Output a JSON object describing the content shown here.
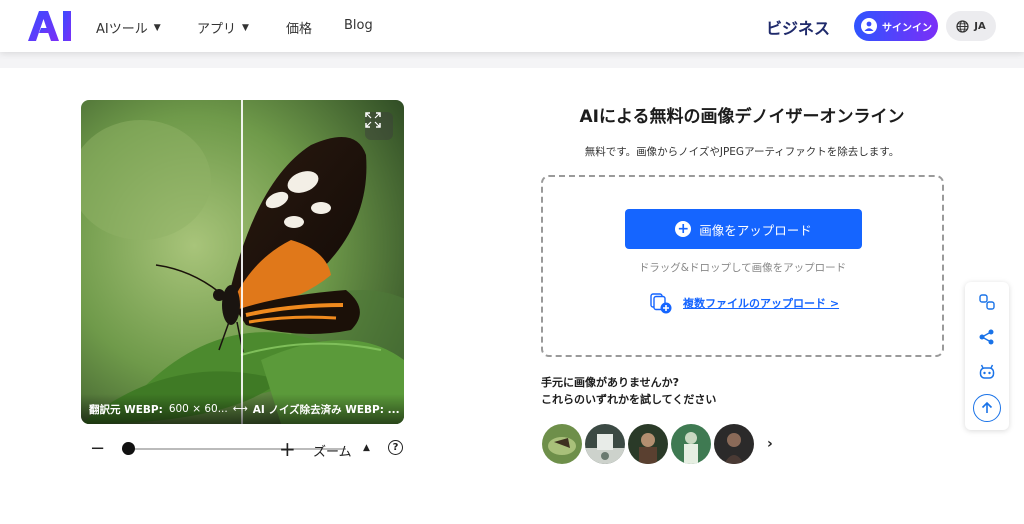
{
  "header": {
    "logo_text": "AI",
    "nav": [
      {
        "label": "AIツール",
        "dropdown": true
      },
      {
        "label": "アプリ",
        "dropdown": true
      },
      {
        "label": "価格",
        "dropdown": false
      },
      {
        "label": "Blog",
        "dropdown": false
      }
    ],
    "business_label": "ビジネス",
    "signin_label": "サインイン",
    "lang_label": "JA"
  },
  "compare": {
    "original_label": "翻訳元 WEBP:",
    "original_size": "600 × 60...",
    "arrow": "⟷",
    "result_label": "AI ノイズ除去済み WEBP: ..."
  },
  "zoom": {
    "label": "ズーム",
    "level": 0
  },
  "main": {
    "title": "AIによる無料の画像デノイザーオンライン",
    "subtitle": "無料です。画像からノイズやJPEGアーティファクトを除去します。",
    "upload_button": "画像をアップロード",
    "drag_text": "ドラッグ&ドロップして画像をアップロード",
    "multi_upload": "複数ファイルのアップロード >",
    "no_image_line1": "手元に画像がありませんか?",
    "no_image_line2": "これらのいずれかを試してください"
  },
  "colors": {
    "accent": "#1565ff",
    "signin_gradient_start": "#2f54ff",
    "signin_gradient_end": "#7b2ff7",
    "business": "#1f2a6b"
  },
  "sidetools": [
    "link-icon",
    "share-icon",
    "bot-icon",
    "arrow-up-icon"
  ]
}
